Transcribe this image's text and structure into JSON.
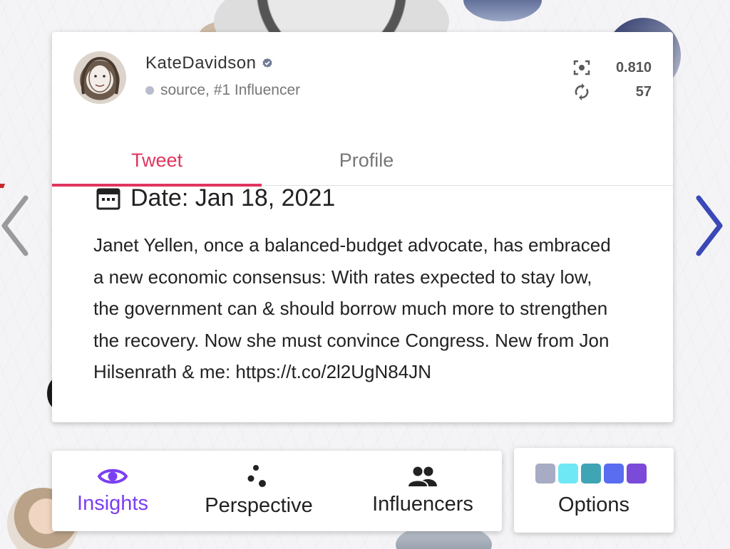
{
  "user": {
    "name": "KateDavidson",
    "subtitle": "source, #1 Influencer",
    "score": "0.810",
    "retweets": "57"
  },
  "tabs": [
    {
      "label": "Tweet",
      "active": true
    },
    {
      "label": "Profile",
      "active": false
    }
  ],
  "tweet": {
    "date": "Date: Jan 18, 2021",
    "text": "Janet Yellen, once a balanced-budget advocate, has embraced a new economic consensus: With rates expected to stay low, the government can & should borrow much more to strengthen the recovery. Now she must convince Congress. New from Jon Hilsenrath & me: https://t.co/2l2UgN84JN"
  },
  "toolbar": {
    "insights_label": "Insights",
    "perspective_label": "Perspective",
    "influencers_label": "Influencers",
    "options_label": "Options"
  },
  "colors": {
    "accent_tab": "#e0365f",
    "accent_insights": "#7b3ff2",
    "nav_right": "#3a48b8",
    "nav_left": "#9a9a9a",
    "swatches": [
      "#a7abc3",
      "#6ee8f4",
      "#3fa5b5",
      "#5a6cf0",
      "#7c4ad8"
    ]
  },
  "icons": {
    "verified": "verified-badge-icon",
    "score": "focus-frame-icon",
    "retweets": "retweet-icon",
    "date": "calendar-icon",
    "insights": "eye-icon",
    "perspective": "dots-cluster-icon",
    "influencers": "people-icon",
    "prev": "chevron-left-icon",
    "next": "chevron-right-icon"
  }
}
